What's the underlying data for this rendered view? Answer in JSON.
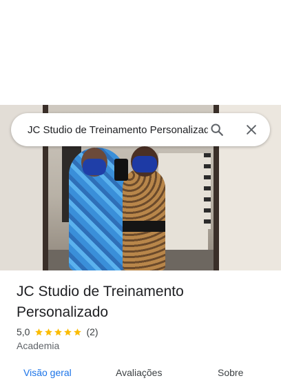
{
  "search": {
    "query": "JC Studio de Treinamento Personalizado",
    "search_icon": "search-icon",
    "close_icon": "close-icon"
  },
  "place": {
    "name": "JC Studio de Treinamento Personalizado",
    "rating": "5,0",
    "stars": 5,
    "review_count": "(2)",
    "category": "Academia"
  },
  "tabs": [
    {
      "label": "Visão geral",
      "active": true
    },
    {
      "label": "Avaliações",
      "active": false
    },
    {
      "label": "Sobre",
      "active": false
    }
  ],
  "colors": {
    "accent": "#1a73e8",
    "star": "#fbbc04",
    "text": "#202124",
    "secondary_text": "#5f6368"
  }
}
